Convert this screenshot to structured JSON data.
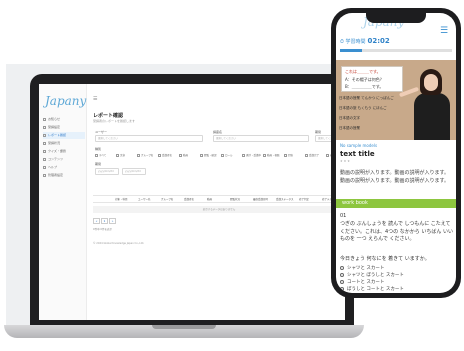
{
  "laptop": {
    "logo": "Japany",
    "menu_icon": "☰",
    "sidebar": [
      {
        "label": "お知らせ",
        "icon": "bell-icon"
      },
      {
        "label": "受講設定",
        "icon": "gear-icon"
      },
      {
        "label": "レポート確認",
        "icon": "report-icon",
        "active": true
      },
      {
        "label": "受講状況",
        "icon": "chart-icon"
      },
      {
        "label": "クイズ・課題",
        "icon": "quiz-icon"
      },
      {
        "label": "コンテンツ",
        "icon": "folder-icon"
      },
      {
        "label": "ヘルプ",
        "icon": "help-icon"
      },
      {
        "label": "管理者設定",
        "icon": "settings-icon"
      }
    ],
    "title": "レポート確認",
    "subtitle": "受講者のレポートを確認します",
    "filters": {
      "user_label": "ユーザー",
      "user_placeholder": "選択してください",
      "course_label": "講座名",
      "course_placeholder": "選択してください",
      "period_label": "期間",
      "period_placeholder": "選択してください",
      "type_label": "種別",
      "date_label": "期間",
      "date_from": "yyyy/mm/dd",
      "date_to": "yyyy/mm/dd"
    },
    "checkboxes": [
      "すべて",
      "文章",
      "グループ名",
      "受講者名",
      "動画",
      "閲覧・確認",
      "ロール",
      "進捗・受講中",
      "動画・視聴",
      "回答",
      "受講完了",
      "修了"
    ],
    "table_headers": [
      "対象・科目",
      "ユーザー名",
      "グループ名",
      "受講者名",
      "動画",
      "閲覧状況",
      "最終受講日時",
      "受講ステータス",
      "修了判定",
      "修了テスト"
    ],
    "empty_message": "表示するデータはありません",
    "pager": [
      "«",
      "1",
      "»"
    ],
    "count_text": "0件中 0件を表示",
    "footer": "© 2024 Global Knowledge Japan Co.,Ltd."
  },
  "phone": {
    "brand": "Japany",
    "menu_icon": "☰",
    "timer_label": "⏱ 学習時間",
    "timer_value": "02:02",
    "progress": 0.2,
    "board_line1": "これは＿＿＿です。",
    "board_line2": "A：その帽子は何色？",
    "board_line3": "B：＿＿＿＿＿です。",
    "wall_words": [
      "日本語の授業  てんかつ  にっぽんご",
      "日本語の旅  もくもう  にほんご",
      "日本語の文字",
      "日本語の授業"
    ],
    "sample_label": "No sample models",
    "text_title": "text title",
    "stars": "★ ★ ★",
    "description": "動画の説明が入ります。動画の説明が入ります。動画の説明が入ります。動画の説明が入ります。",
    "workbook_label": "work book",
    "question_no": "01",
    "question_text": "つぎの ぶんしょうを 読んで しつもんに こたえて ください。これは、4つの なかから いちばん いい ものを 一つ えらんで ください。",
    "question_ask": "今日きょう 何なにを 着きて いますか。",
    "options": [
      "シャツと スカート",
      "シャツと ぼうしと スカート",
      "コートと スカート",
      "ぼうしと コートと スカート"
    ]
  }
}
